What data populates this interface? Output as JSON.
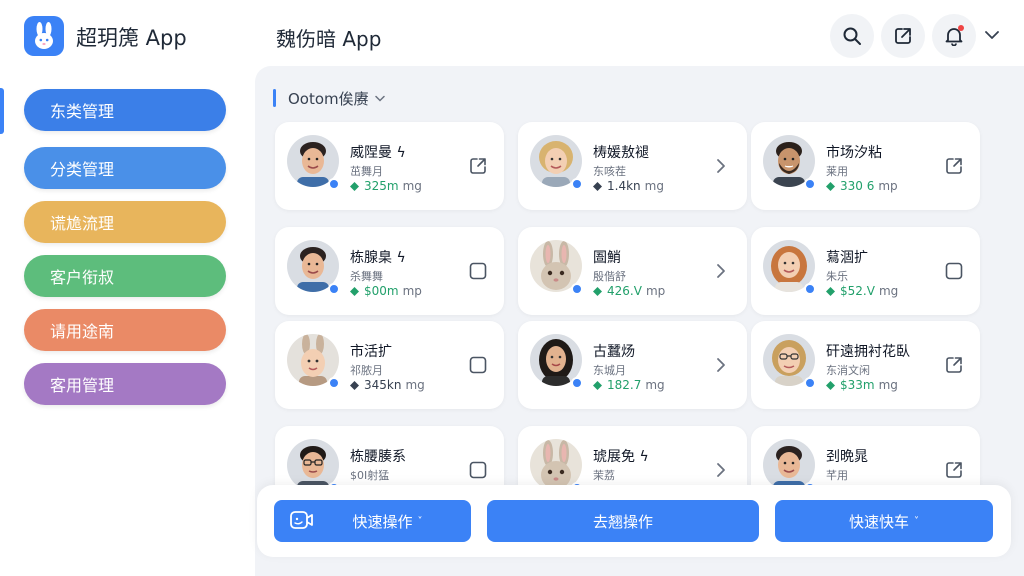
{
  "header": {
    "app_title": "超玥箎  App",
    "page_title": "魏伤暗 App",
    "logo_icon": "rabbit-icon",
    "buttons": [
      "search-icon",
      "share-icon",
      "bell-icon"
    ]
  },
  "sidebar": {
    "items": [
      {
        "label": "东类管理",
        "color": "#3b7fe8"
      },
      {
        "label": "分类管理",
        "color": "#4a90e8"
      },
      {
        "label": "谎尯流理",
        "color": "#e8b55c"
      },
      {
        "label": "客户衔叔",
        "color": "#5dbd7c"
      },
      {
        "label": "请用途南",
        "color": "#ea8a66"
      },
      {
        "label": "客用管理",
        "color": "#a479c4"
      }
    ]
  },
  "filter": {
    "label": "Ootom俟赓"
  },
  "cards": [
    {
      "name": "威陧曼 ϟ",
      "sub": "茁舞月",
      "value": "325m",
      "unit": "mg",
      "value_color": "#22a06b",
      "action": "external-link-icon",
      "avatar": "man"
    },
    {
      "name": "梼媛敖褪",
      "sub": "东咳茬",
      "value": "1.4kn",
      "unit": "mg",
      "value_color": "#374151",
      "action": "chevron-right-icon",
      "avatar": "woman-older"
    },
    {
      "name": "市场汐粘",
      "sub": "莱用",
      "value": "330 6",
      "unit": "mp",
      "value_color": "#22a06b",
      "action": "external-link-icon",
      "avatar": "man-beard"
    },
    {
      "name": "栋腺臬 ϟ",
      "sub": "杀舞舞",
      "value": "$00m",
      "unit": "mp",
      "value_color": "#22a06b",
      "action": "checkbox-icon",
      "avatar": "man"
    },
    {
      "name": "圄鮹",
      "sub": "殷偕舒",
      "value": "426.V",
      "unit": "mp",
      "value_color": "#22a06b",
      "action": "chevron-right-icon",
      "avatar": "rabbit"
    },
    {
      "name": "蕮涸扩",
      "sub": "朱乐",
      "value": "$52.V",
      "unit": "mg",
      "value_color": "#22a06b",
      "action": "checkbox-icon",
      "avatar": "woman-red"
    },
    {
      "name": "市活扩",
      "sub": "祁脓月",
      "value": "345kn",
      "unit": "mg",
      "value_color": "#374151",
      "action": "checkbox-icon",
      "avatar": "child-ears"
    },
    {
      "name": "古蠶炀",
      "sub": "东城月",
      "value": "182.7",
      "unit": "mg",
      "value_color": "#22a06b",
      "action": "chevron-right-icon",
      "avatar": "woman-dark"
    },
    {
      "name": "矸遠拥衬花臥",
      "sub": "东消文闲",
      "value": "$33m",
      "unit": "mg",
      "value_color": "#22a06b",
      "action": "external-link-icon",
      "avatar": "woman-glasses"
    },
    {
      "name": "栋腰腠系",
      "sub": "$0I射猛",
      "value": "",
      "unit": "",
      "value_color": "#374151",
      "action": "checkbox-icon",
      "avatar": "man-glasses"
    },
    {
      "name": "琥展免 ϟ",
      "sub": "茉荔",
      "value": "",
      "unit": "",
      "value_color": "#374151",
      "action": "chevron-right-icon",
      "avatar": "rabbit"
    },
    {
      "name": "刭晩晁",
      "sub": "芊用",
      "value": "",
      "unit": "",
      "value_color": "#374151",
      "action": "external-link-icon",
      "avatar": "man"
    }
  ],
  "actions": [
    {
      "label": "快速操作",
      "caret": "˅"
    },
    {
      "label": "去翘操作",
      "caret": ""
    },
    {
      "label": "快速快车",
      "caret": "˅"
    }
  ]
}
